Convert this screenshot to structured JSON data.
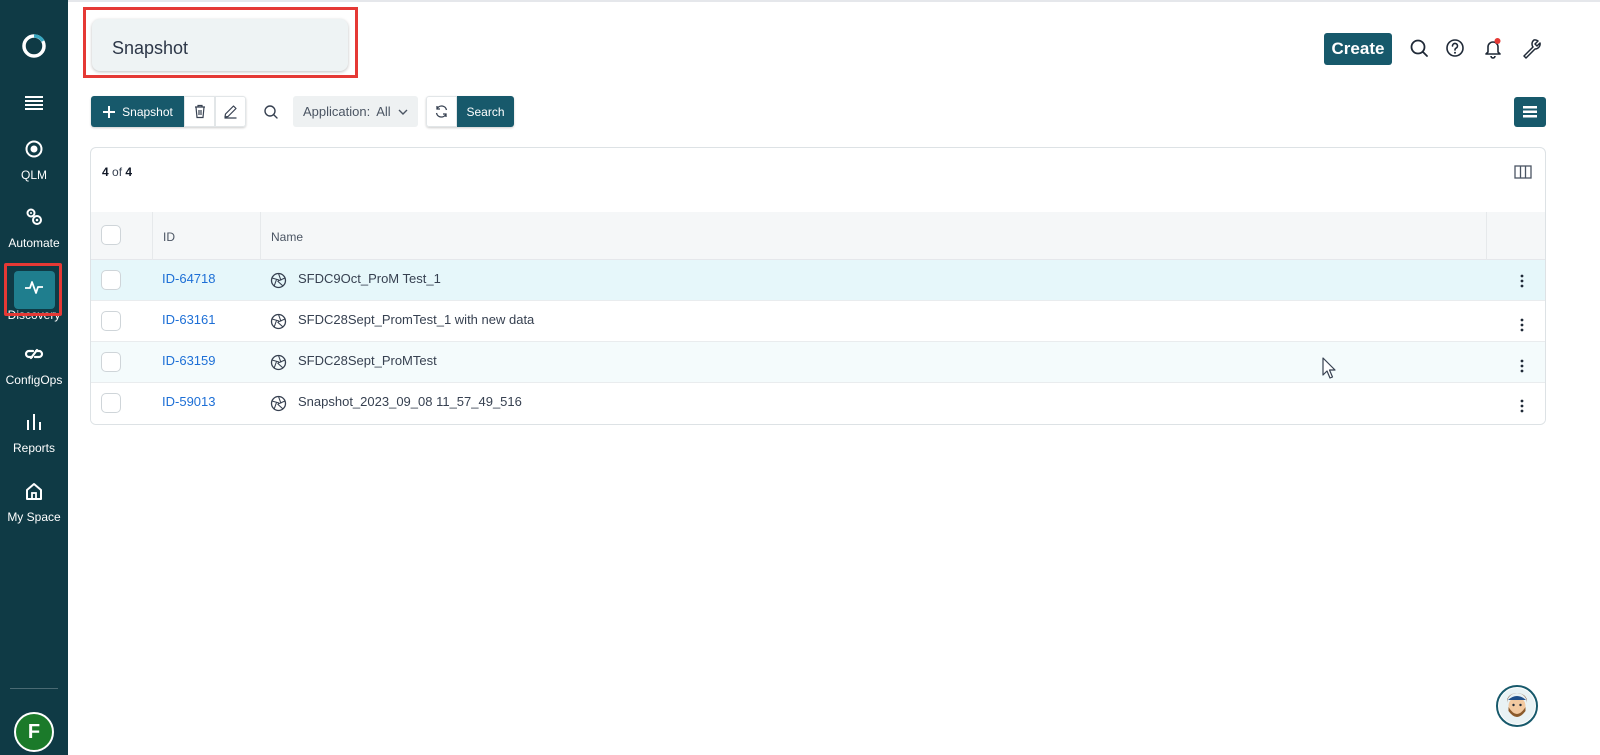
{
  "sidebar": {
    "logo": "ring-logo-icon",
    "menu_icon": "hamburger-menu-icon",
    "items": [
      {
        "label": "QLM",
        "icon": "target-icon"
      },
      {
        "label": "Automate",
        "icon": "gears-icon"
      },
      {
        "label": "Discovery",
        "icon": "pulse-icon",
        "active": true
      },
      {
        "label": "ConfigOps",
        "icon": "link-icon"
      },
      {
        "label": "Reports",
        "icon": "bar-chart-icon"
      },
      {
        "label": "My Space",
        "icon": "home-icon"
      }
    ],
    "user_initial": "F"
  },
  "header": {
    "title": "Snapshot",
    "create_label": "Create",
    "icons": [
      "search-icon",
      "help-icon",
      "bell-icon",
      "wrench-icon"
    ],
    "notification_dot_color": "#e53935"
  },
  "toolbar": {
    "add_label": "Snapshot",
    "filter_label": "Application:",
    "filter_value": "All",
    "search_label": "Search"
  },
  "table": {
    "count_shown": "4",
    "count_of": "of",
    "count_total": "4",
    "columns": [
      "ID",
      "Name"
    ],
    "rows": [
      {
        "id_prefix": "ID-",
        "id_num": "64718",
        "name": "SFDC9Oct_ProM Test_1"
      },
      {
        "id_prefix": "ID-",
        "id_num": "63161",
        "name": "SFDC28Sept_PromTest_1 with new data"
      },
      {
        "id_prefix": "ID-",
        "id_num": "63159",
        "name": "SFDC28Sept_ProMTest"
      },
      {
        "id_prefix": "ID-",
        "id_num": "59013",
        "name": "Snapshot_2023_09_08 11_57_49_516"
      }
    ]
  },
  "colors": {
    "sidebar_bg": "#0f3a45",
    "primary": "#17596b",
    "link": "#1d6fd6",
    "highlight": "#e53935"
  }
}
